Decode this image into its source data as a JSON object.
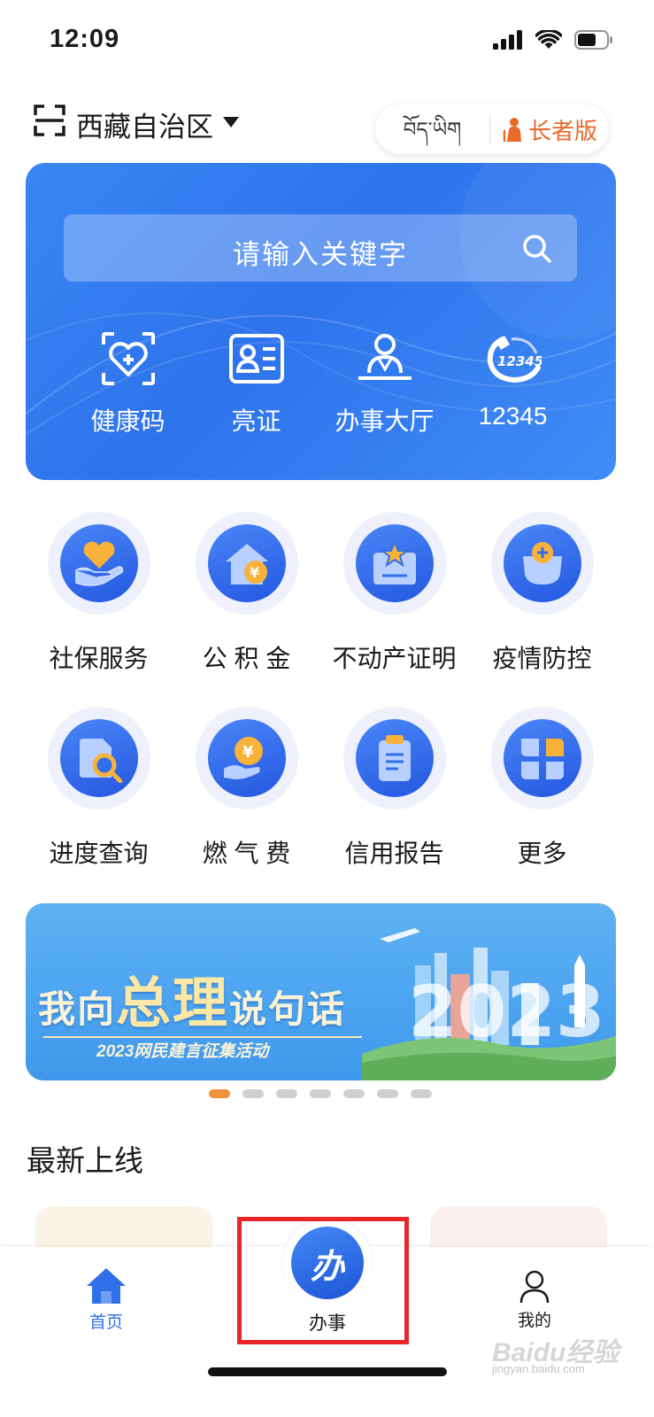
{
  "status_bar": {
    "time": "12:09"
  },
  "header": {
    "region": "西藏自治区",
    "lang_tibetan": "བོད་ཡིག",
    "elder_mode": "长者版"
  },
  "hero": {
    "search_placeholder": "请输入关键字",
    "quick_items": [
      {
        "label": "健康码",
        "icon": "health-code-icon"
      },
      {
        "label": "亮证",
        "icon": "id-card-icon"
      },
      {
        "label": "办事大厅",
        "icon": "service-hall-icon"
      },
      {
        "label": "12345",
        "icon": "hotline-12345-icon",
        "icon_text": "12345"
      }
    ]
  },
  "services": [
    {
      "label": "社保服务",
      "icon": "social-security-icon"
    },
    {
      "label": "公 积 金",
      "icon": "housing-fund-icon"
    },
    {
      "label": "不动产证明",
      "icon": "real-estate-certificate-icon"
    },
    {
      "label": "疫情防控",
      "icon": "epidemic-control-icon"
    },
    {
      "label": "进度查询",
      "icon": "progress-query-icon"
    },
    {
      "label": "燃 气 费",
      "icon": "gas-fee-icon"
    },
    {
      "label": "信用报告",
      "icon": "credit-report-icon"
    },
    {
      "label": "更多",
      "icon": "more-icon"
    }
  ],
  "banner": {
    "title_pre": "我向",
    "title_big": "总理",
    "title_post": "说句话",
    "subtitle": "2023网民建言征集活动",
    "art_text": "2023",
    "page_count": 7,
    "active_index": 0
  },
  "section": {
    "latest_title": "最新上线"
  },
  "tab_bar": {
    "home": "首页",
    "center": "办事",
    "center_glyph": "办",
    "mine": "我的"
  },
  "watermark": {
    "main": "Baidu经验",
    "sub": "jingyan.baidu.com"
  },
  "colors": {
    "primary": "#2f6fe8",
    "elder_accent": "#e8692b",
    "highlight": "#e8262a",
    "dot_active": "#f0913c"
  }
}
